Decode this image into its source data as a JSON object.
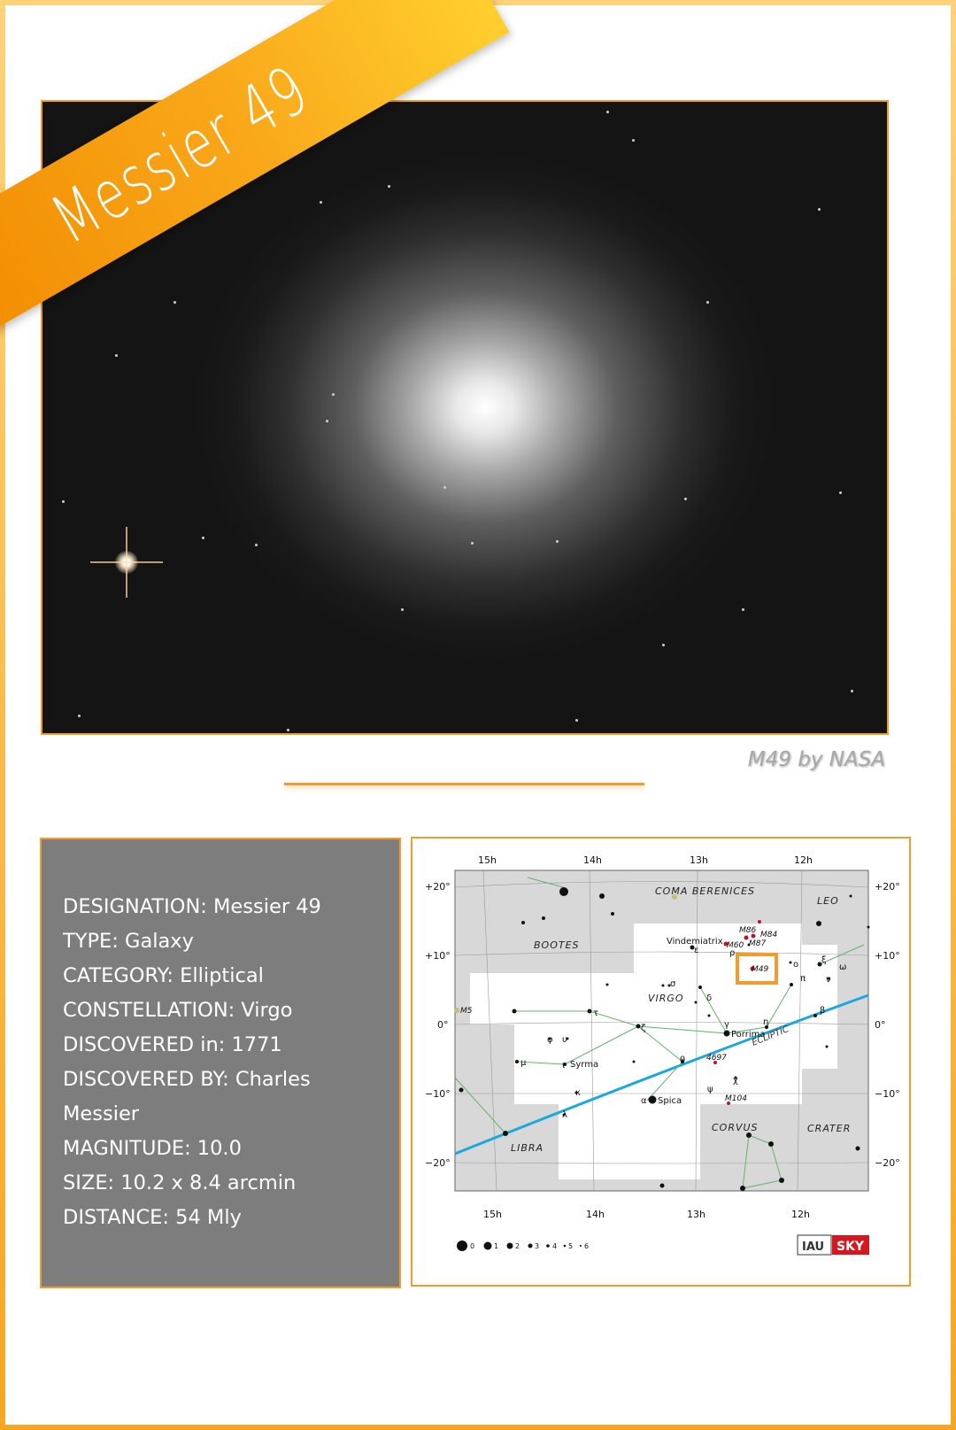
{
  "title": "Messier 49",
  "photo": {
    "caption": "M49 by NASA"
  },
  "details": [
    "DESIGNATION: Messier 49",
    "TYPE: Galaxy",
    "CATEGORY: Elliptical",
    "CONSTELLATION: Virgo",
    "DISCOVERED in: 1771",
    "DISCOVERED BY: Charles Messier",
    "MAGNITUDE: 10.0",
    "SIZE: 10.2 x 8.4 arcmin",
    "DISTANCE: 54 Mly"
  ],
  "starmap": {
    "ra_top": [
      "15h",
      "14h",
      "13h",
      "12h"
    ],
    "ra_bottom": [
      "15h",
      "14h",
      "13h",
      "12h"
    ],
    "dec_left": [
      "+20°",
      "+10°",
      "0°",
      "−10°",
      "−20°"
    ],
    "dec_right": [
      "+20°",
      "+10°",
      "0°",
      "−10°",
      "−20°"
    ],
    "constellations": [
      "COMA BERENICES",
      "LEO",
      "BOOTES",
      "VIRGO",
      "CORVUS",
      "CRATER",
      "LIBRA"
    ],
    "stars": [
      "Vindemiatrix",
      "Porrima",
      "Syrma",
      "Spica"
    ],
    "objects": [
      "M86",
      "M84",
      "M60",
      "M87",
      "M49",
      "M5",
      "4697",
      "M104"
    ],
    "ecliptic": "ECLIPTIC",
    "greek": [
      "ε",
      "ρ",
      "ο",
      "ξ",
      "ω",
      "π",
      "ν",
      "β",
      "σ",
      "δ",
      "τ",
      "ζ",
      "γ",
      "η",
      "φ",
      "υ",
      "μ",
      "ι",
      "θ",
      "χ",
      "ψ",
      "κ",
      "λ",
      "α"
    ],
    "magnitudes": [
      "0",
      "1",
      "2",
      "3",
      "4",
      "5",
      "6"
    ],
    "logos": {
      "left": "IAU",
      "right": "SKY"
    },
    "highlight": "M49",
    "colors": {
      "highlight": "#f39c2d",
      "ecliptic": "#1ea7dc",
      "object": "#c8102e",
      "lines": "#5fb46b",
      "shade": "#d8d8d8"
    }
  },
  "colors": {
    "accent": "#f39c2d",
    "panel": "#7d7d7d"
  }
}
